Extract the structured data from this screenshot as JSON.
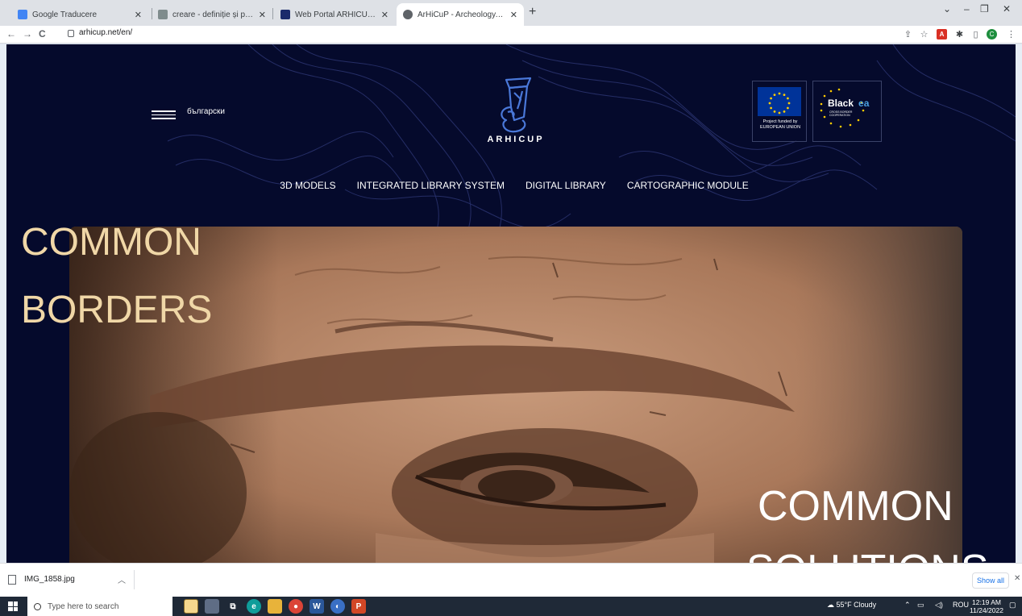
{
  "browser": {
    "tabs": [
      {
        "title": "Google Traducere",
        "favicon_color": "#4285f4",
        "active": false
      },
      {
        "title": "creare - definiție și paradigmă | c",
        "favicon_color": "#7f8c8d",
        "active": false
      },
      {
        "title": "Web Portal ARHICUP - Arhicup.c",
        "favicon_color": "#1b2a6b",
        "active": false
      },
      {
        "title": "ArHiCuP - Archeology, history an",
        "favicon_color": "#5f6368",
        "active": true
      }
    ],
    "new_tab_label": "+",
    "url": "arhicup.net/en/"
  },
  "site": {
    "language_label": "български",
    "brand": "ARHICUP",
    "eu_text_line1": "Project funded by",
    "eu_text_line2": "EUROPEAN UNION",
    "blacksea_text": "Black",
    "blacksea_text2": "ea",
    "blacksea_sub": "CROSS BORDER COOPERATION",
    "nav": [
      "3D MODELS",
      "INTEGRATED LIBRARY SYSTEM",
      "DIGITAL LIBRARY",
      "CARTOGRAPHIC MODULE"
    ],
    "headline_line1": "COMMON",
    "headline_line2": "BORDERS",
    "sub_headline_line1": "COMMON",
    "sub_headline_line2": "SOLUTIONS",
    "colors": {
      "background": "#050a2c",
      "headline": "#f0d7a7",
      "accent_eu": "#003399"
    }
  },
  "downloads": {
    "file_name": "IMG_1858.jpg",
    "show_all_label": "Show all"
  },
  "taskbar": {
    "search_placeholder": "Type here to search",
    "weather": "55°F  Cloudy",
    "language": "ROU",
    "time": "12:19 AM",
    "date": "11/24/2022"
  }
}
